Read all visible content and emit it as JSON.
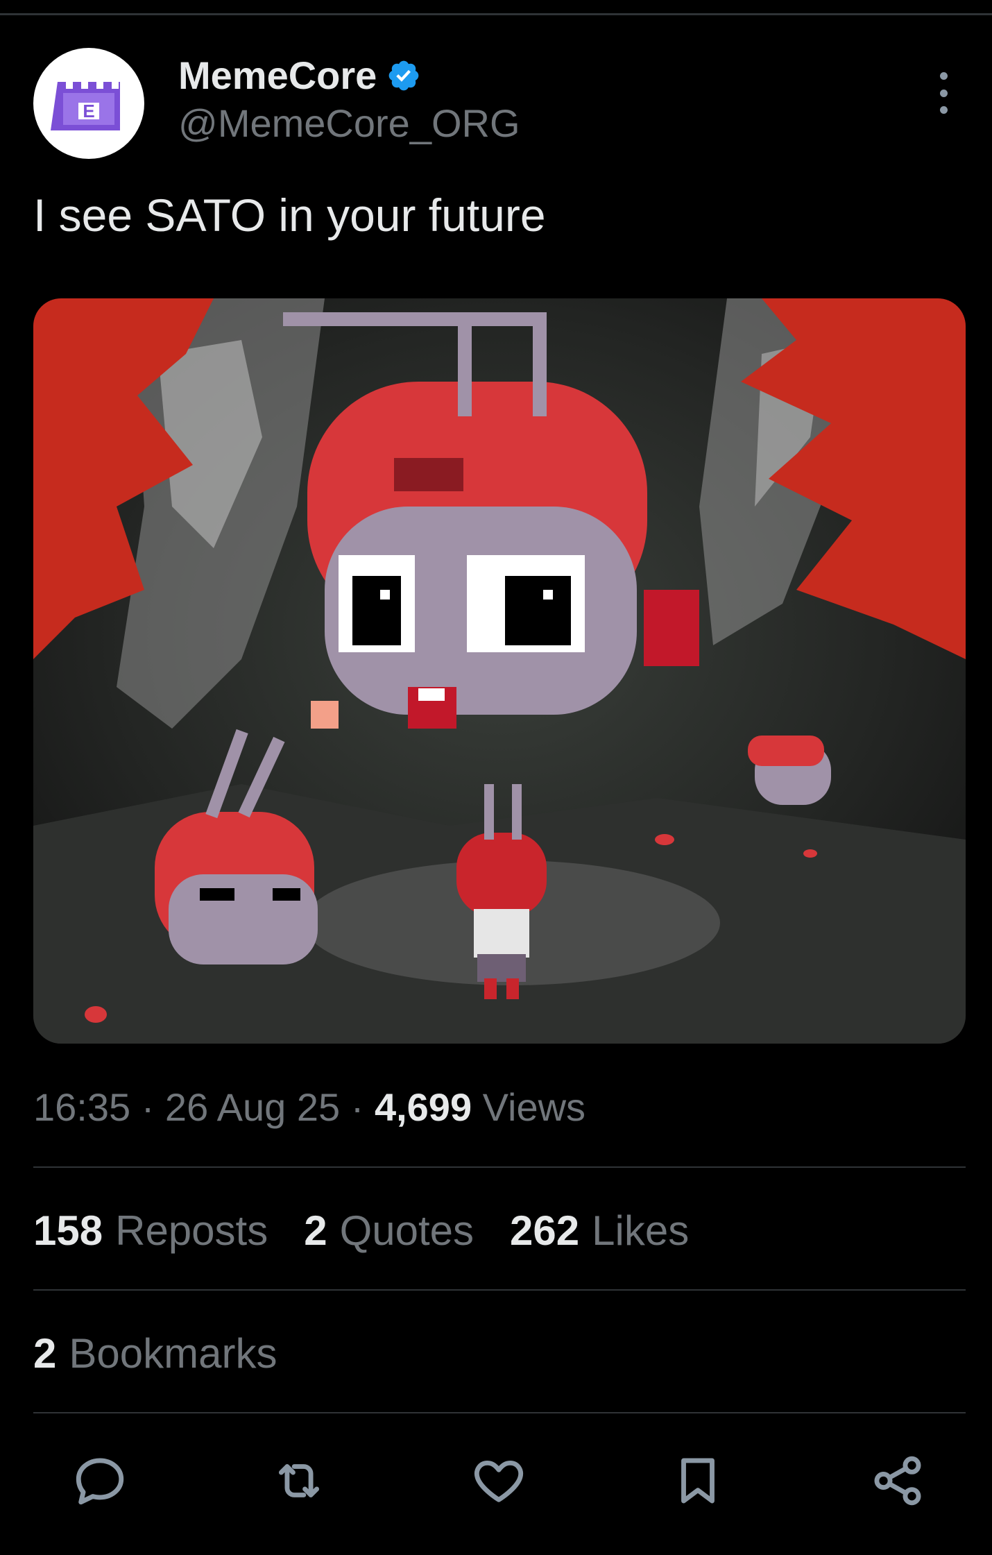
{
  "author": {
    "display_name": "MemeCore",
    "handle": "@MemeCore_ORG",
    "verified_icon": "verified-badge-icon",
    "avatar_icon": "memecore-castle-logo",
    "avatar_letter": "E"
  },
  "more_icon": "more-vertical-icon",
  "post": {
    "text": "I see SATO in your future",
    "media_description_icon": "pixel-art-image"
  },
  "meta": {
    "time": "16:35",
    "dot1": "·",
    "date": "26 Aug 25",
    "dot2": "·",
    "views_count": "4,699",
    "views_label": "Views"
  },
  "stats": {
    "reposts_count": "158",
    "reposts_label": "Reposts",
    "quotes_count": "2",
    "quotes_label": "Quotes",
    "likes_count": "262",
    "likes_label": "Likes",
    "bookmarks_count": "2",
    "bookmarks_label": "Bookmarks"
  },
  "actions": [
    "reply-icon",
    "repost-icon",
    "like-icon",
    "bookmark-icon",
    "share-icon"
  ],
  "colors": {
    "background": "#000000",
    "primary_text": "#e7e9ea",
    "secondary_text": "#71767b",
    "verified": "#1d9bf0",
    "divider": "#2f3336",
    "avatar_purple": "#7b4fd6"
  }
}
